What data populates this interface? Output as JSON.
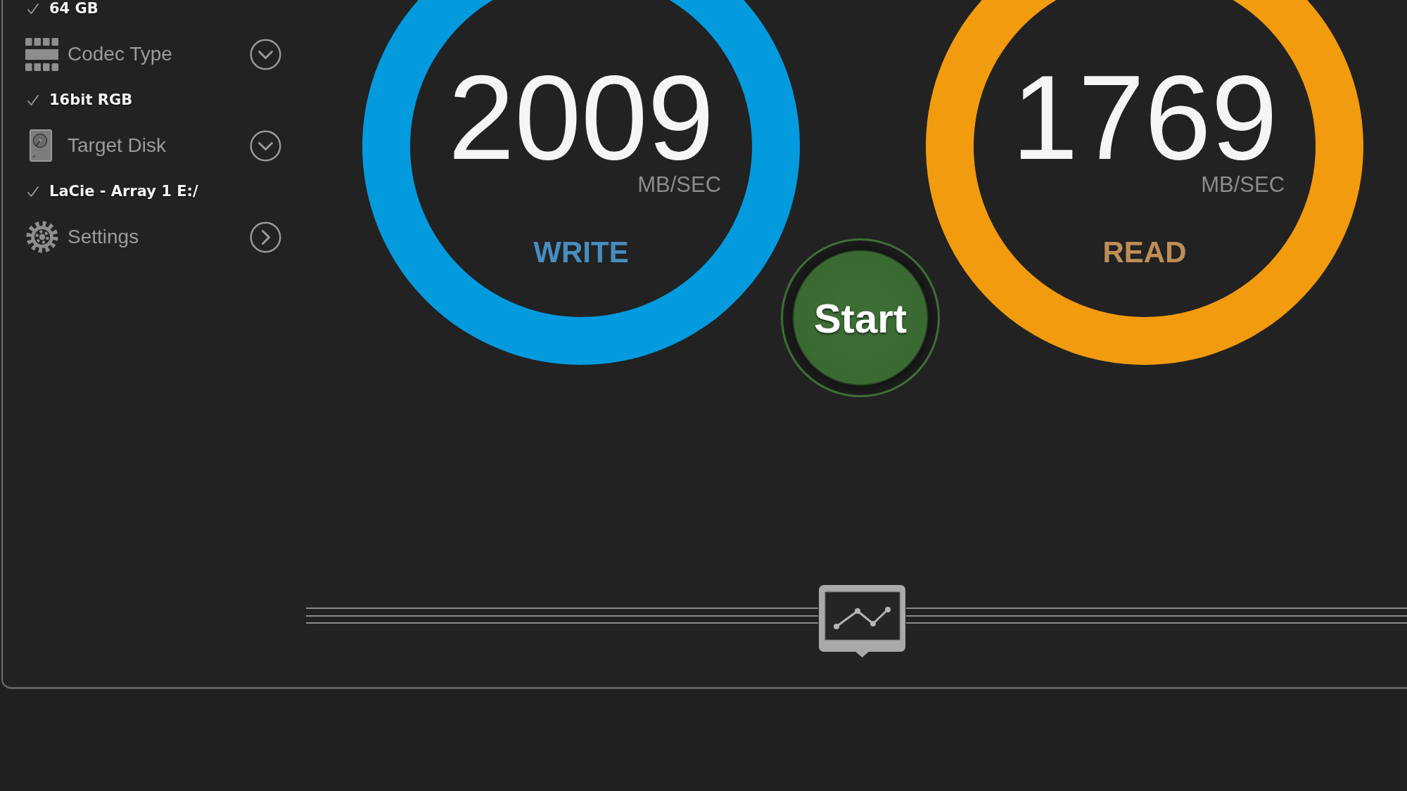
{
  "sidebar": {
    "items": [
      {
        "kind": "option",
        "label": "64 GB",
        "checked": true
      },
      {
        "kind": "dropdown",
        "label": "Codec Type"
      },
      {
        "kind": "option",
        "label": "16bit RGB",
        "checked": true
      },
      {
        "kind": "dropdown",
        "label": "Target Disk"
      },
      {
        "kind": "option",
        "label": "LaCie - Array 1 E:/",
        "checked": true
      },
      {
        "kind": "link",
        "label": "Settings"
      }
    ]
  },
  "gauges": [
    {
      "label": "WRITE",
      "value": "2009",
      "unit": "MB/SEC",
      "color": "#049ade"
    },
    {
      "label": "READ",
      "value": "1769",
      "unit": "MB/SEC",
      "color": "#f29b0f"
    }
  ],
  "start_button": {
    "label": "Start"
  }
}
